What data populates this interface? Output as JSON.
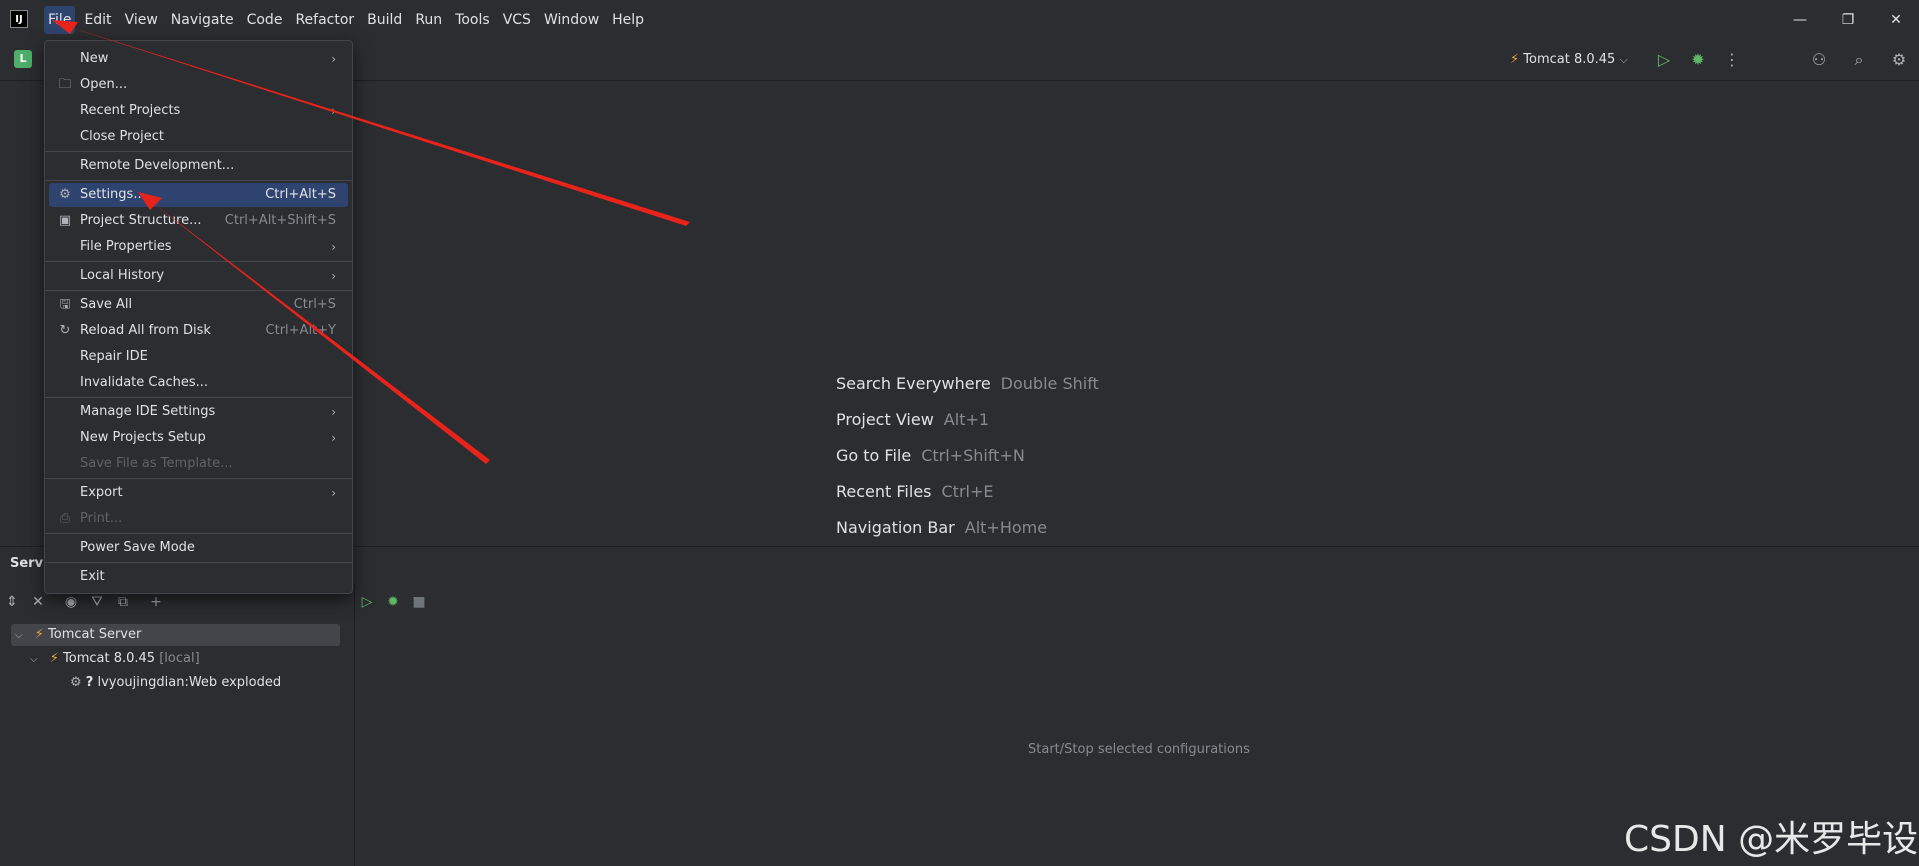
{
  "app": {
    "logo_text": "IJ"
  },
  "menubar": {
    "items": [
      "File",
      "Edit",
      "View",
      "Navigate",
      "Code",
      "Refactor",
      "Build",
      "Run",
      "Tools",
      "VCS",
      "Window",
      "Help"
    ]
  },
  "window_controls": {
    "minimize": "—",
    "restore": "❐",
    "close": "✕"
  },
  "toolbar": {
    "project_badge": "L",
    "run_config": "Tomcat 8.0.45",
    "run_config_chevron": "⌵"
  },
  "file_menu": {
    "items": [
      {
        "label": "New",
        "shortcut": "",
        "submenu": true,
        "icon": "",
        "disabled": false
      },
      {
        "label": "Open...",
        "shortcut": "",
        "submenu": false,
        "icon": "folder-icon",
        "disabled": false
      },
      {
        "label": "Recent Projects",
        "shortcut": "",
        "submenu": true,
        "icon": "",
        "disabled": false
      },
      {
        "label": "Close Project",
        "shortcut": "",
        "submenu": false,
        "icon": "",
        "disabled": false
      },
      {
        "label": "Remote Development...",
        "shortcut": "",
        "submenu": false,
        "icon": "",
        "disabled": false
      },
      {
        "label": "Settings...",
        "shortcut": "Ctrl+Alt+S",
        "submenu": false,
        "icon": "gear-icon",
        "disabled": false
      },
      {
        "label": "Project Structure...",
        "shortcut": "Ctrl+Alt+Shift+S",
        "submenu": false,
        "icon": "project-structure-icon",
        "disabled": false
      },
      {
        "label": "File Properties",
        "shortcut": "",
        "submenu": true,
        "icon": "",
        "disabled": false
      },
      {
        "label": "Local History",
        "shortcut": "",
        "submenu": true,
        "icon": "",
        "disabled": false
      },
      {
        "label": "Save All",
        "shortcut": "Ctrl+S",
        "submenu": false,
        "icon": "save-icon",
        "disabled": false
      },
      {
        "label": "Reload All from Disk",
        "shortcut": "Ctrl+Alt+Y",
        "submenu": false,
        "icon": "reload-icon",
        "disabled": false
      },
      {
        "label": "Repair IDE",
        "shortcut": "",
        "submenu": false,
        "icon": "",
        "disabled": false
      },
      {
        "label": "Invalidate Caches...",
        "shortcut": "",
        "submenu": false,
        "icon": "",
        "disabled": false
      },
      {
        "label": "Manage IDE Settings",
        "shortcut": "",
        "submenu": true,
        "icon": "",
        "disabled": false
      },
      {
        "label": "New Projects Setup",
        "shortcut": "",
        "submenu": true,
        "icon": "",
        "disabled": false
      },
      {
        "label": "Save File as Template...",
        "shortcut": "",
        "submenu": false,
        "icon": "",
        "disabled": true
      },
      {
        "label": "Export",
        "shortcut": "",
        "submenu": true,
        "icon": "",
        "disabled": false
      },
      {
        "label": "Print...",
        "shortcut": "",
        "submenu": false,
        "icon": "print-icon",
        "disabled": true
      },
      {
        "label": "Power Save Mode",
        "shortcut": "",
        "submenu": false,
        "icon": "",
        "disabled": false
      },
      {
        "label": "Exit",
        "shortcut": "",
        "submenu": false,
        "icon": "",
        "disabled": false
      }
    ],
    "highlighted": "Settings..."
  },
  "editor_hints": [
    {
      "action": "Search Everywhere",
      "shortcut": "Double Shift"
    },
    {
      "action": "Project View",
      "shortcut": "Alt+1"
    },
    {
      "action": "Go to File",
      "shortcut": "Ctrl+Shift+N"
    },
    {
      "action": "Recent Files",
      "shortcut": "Ctrl+E"
    },
    {
      "action": "Navigation Bar",
      "shortcut": "Alt+Home"
    }
  ],
  "services": {
    "title": "Servi",
    "tree": [
      {
        "label": "Tomcat Server",
        "suffix": ""
      },
      {
        "label": "Tomcat 8.0.45",
        "suffix": "[local]"
      },
      {
        "label": "lvyoujingdian:Web exploded",
        "suffix": ""
      }
    ],
    "empty_message": "Start/Stop selected configurations"
  },
  "watermark": "CSDN @米罗毕设",
  "colors": {
    "background": "#2b2d30",
    "menu_highlight": "#2e436e",
    "run_green": "#5fb865",
    "annotation_arrow": "#e8231b"
  }
}
